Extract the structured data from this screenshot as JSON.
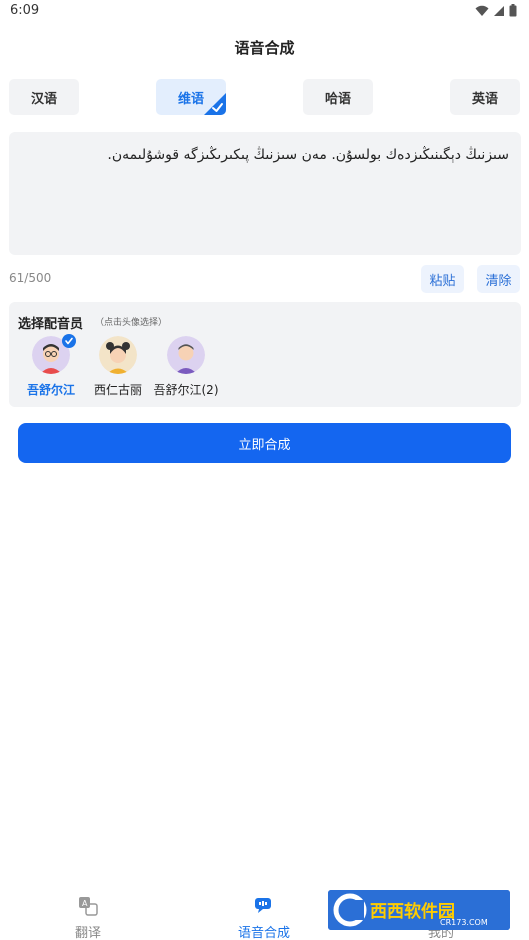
{
  "status_bar": {
    "time": "6:09"
  },
  "header": {
    "title": "语音合成"
  },
  "language_tabs": [
    {
      "label": "汉语",
      "active": false
    },
    {
      "label": "维语",
      "active": true
    },
    {
      "label": "哈语",
      "active": false
    },
    {
      "label": "英语",
      "active": false
    }
  ],
  "input": {
    "text": "سىزنىڭ دېگىنىڭىزدەك بولسۇن. مەن سىزنىڭ پىكىرىڭىزگە قوشۇلىمەن.",
    "counter": "61/500",
    "paste_label": "粘贴",
    "clear_label": "清除"
  },
  "voice_panel": {
    "heading": "选择配音员",
    "hint": "（点击头像选择）",
    "voices": [
      {
        "name": "吾舒尔江",
        "selected": true
      },
      {
        "name": "西仁古丽",
        "selected": false
      },
      {
        "name": "吾舒尔江(2)",
        "selected": false
      }
    ]
  },
  "synth_button": {
    "label": "立即合成"
  },
  "bottom_nav": {
    "items": [
      {
        "label": "翻译",
        "icon": "translate-icon",
        "active": false
      },
      {
        "label": "语音合成",
        "icon": "voice-synthesis-icon",
        "active": true
      },
      {
        "label": "我的",
        "icon": "profile-icon",
        "active": false
      }
    ]
  },
  "watermark": {
    "text": "西西软件园",
    "subtext": "CR173.COM"
  },
  "colors": {
    "accent": "#1466f0",
    "selected_text": "#1a73e8",
    "panel_bg": "#f2f3f5"
  }
}
